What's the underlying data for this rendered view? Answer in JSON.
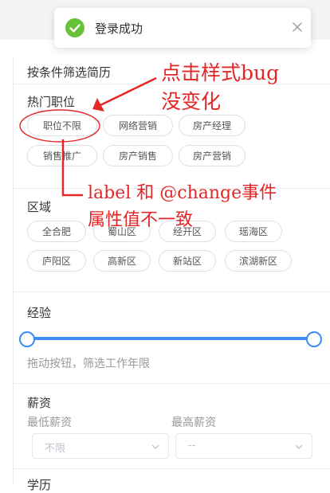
{
  "toast": {
    "message": "登录成功",
    "icon": "check-circle-icon",
    "color": "#67c23a"
  },
  "filter": {
    "heading": "按条件筛选简历",
    "hot_jobs": {
      "label": "热门职位",
      "chips": [
        "职位不限",
        "网络营销",
        "房产经理",
        "销售推广",
        "房产销售",
        "房产营销"
      ]
    },
    "region": {
      "label": "区域",
      "chips": [
        "全合肥",
        "蜀山区",
        "经开区",
        "瑶海区",
        "庐阳区",
        "高新区",
        "新站区",
        "滨湖新区"
      ]
    },
    "experience": {
      "label": "经验",
      "hint": "拖动按钮，筛选工作年限",
      "range_fraction": [
        0,
        1
      ]
    },
    "salary": {
      "label": "薪资",
      "min_label": "最低薪资",
      "max_label": "最高薪资",
      "min_value": "不限",
      "max_value": "--"
    },
    "next_section_label": "学历"
  },
  "annotations": {
    "top": "点击样式bug",
    "top_line2": "没变化",
    "middle": "label 和 @change事件",
    "middle_line2": "属性值不一致",
    "color": "#e32727"
  },
  "colors": {
    "accent": "#3b8cf5",
    "border": "#dcdfe6"
  }
}
